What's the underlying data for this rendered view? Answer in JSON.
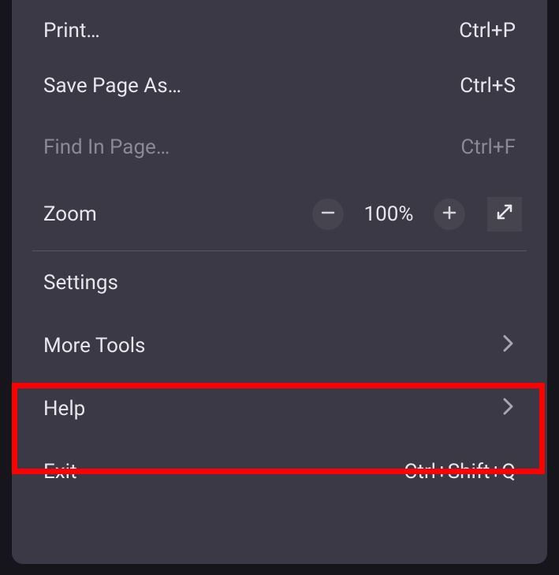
{
  "menu": {
    "print": {
      "label": "Print…",
      "shortcut": "Ctrl+P"
    },
    "save_page": {
      "label": "Save Page As…",
      "shortcut": "Ctrl+S"
    },
    "find": {
      "label": "Find In Page…",
      "shortcut": "Ctrl+F"
    },
    "zoom": {
      "label": "Zoom",
      "value": "100%"
    },
    "settings": {
      "label": "Settings"
    },
    "more_tools": {
      "label": "More Tools"
    },
    "help": {
      "label": "Help"
    },
    "exit": {
      "label": "Exit",
      "shortcut": "Ctrl+Shift+Q"
    }
  }
}
